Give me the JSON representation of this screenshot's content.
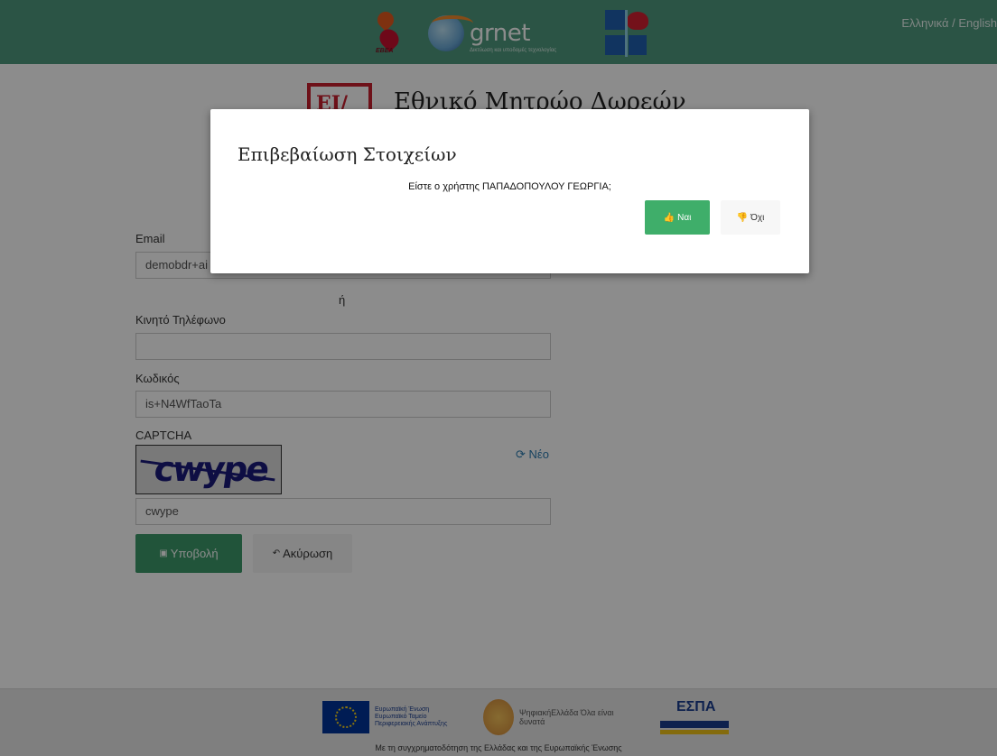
{
  "header": {
    "language_switch": "Ελληνικά / English",
    "logos": {
      "ebea_text": "ΕΒΕΑ",
      "grnet_text": "grnet",
      "grnet_subtitle": "Δικτύωση και υποδομές τεχνολογίας"
    }
  },
  "page": {
    "eidia_logo_text": "ΕΙ/ΙΑ",
    "title": "Εθνικό Μητρώο Δωρεών"
  },
  "form": {
    "email_label": "Email",
    "email_value": "demobdr+ai",
    "or_text": "ή",
    "phone_label": "Κινητό Τηλέφωνο",
    "phone_value": "",
    "password_label": "Κωδικός",
    "password_value": "is+N4WfTaoTa",
    "captcha_label": "CAPTCHA",
    "captcha_image_text": "cwype",
    "refresh_label": "Νέο",
    "captcha_value": "cwype",
    "submit_label": "Υποβολή",
    "cancel_label": "Ακύρωση"
  },
  "footer": {
    "eu_text": "Ευρωπαϊκή Ένωση Ευρωπαϊκό Ταμείο Περιφερειακής Ανάπτυξης",
    "digital_text": "ΨηφιακήΕλλάδα Όλα είναι δυνατά",
    "espa_text": "ΕΣΠΑ",
    "cofunding_text": "Με τη συγχρηματοδότηση της Ελλάδας και της Ευρωπαϊκής Ένωσης"
  },
  "modal": {
    "title": "Επιβεβαίωση Στοιχείων",
    "question": "Είστε ο χρήστης ΠΑΠΑΔΟΠΟΥΛΟΥ ΓΕΩΡΓΙΑ;",
    "yes_label": "Ναι",
    "no_label": "Όχι"
  },
  "colors": {
    "header_bg": "#4f9a7f",
    "primary_green": "#3d9a6b",
    "modal_yes_green": "#3fae6a",
    "link_blue": "#2a7ab0"
  }
}
